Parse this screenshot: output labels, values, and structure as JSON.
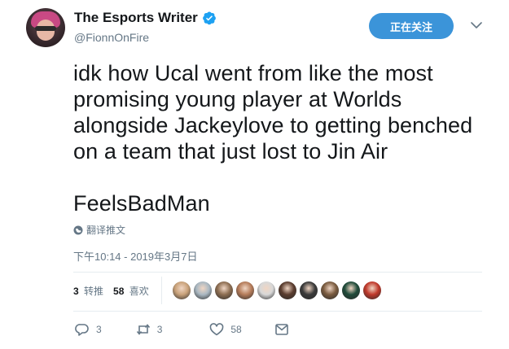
{
  "author": {
    "display_name": "The Esports Writer",
    "handle": "@FionnOnFire",
    "verified": true
  },
  "follow_button": {
    "label": "正在关注"
  },
  "tweet": {
    "text_lines": [
      "idk how Ucal went from like the most",
      "promising young player at Worlds",
      "alongside Jackeylove to getting benched",
      "on a team that just lost to Jin Air"
    ],
    "text_extra": "FeelsBadMan",
    "translate_label": "翻译推文",
    "timestamp": "下午10:14 - 2019年3月7日"
  },
  "stats": {
    "retweets_count": "3",
    "retweets_label": "转推",
    "likes_count": "58",
    "likes_label": "喜欢"
  },
  "likers": [
    {
      "color": "#c9a27a"
    },
    {
      "color": "#aab8c2"
    },
    {
      "color": "#8d6e52"
    },
    {
      "color": "#b57c5a"
    },
    {
      "color": "#d8d8d8"
    },
    {
      "color": "#5a3c2e"
    },
    {
      "color": "#3a3a3a"
    },
    {
      "color": "#7a5b3f"
    },
    {
      "color": "#1f4b3a"
    },
    {
      "color": "#c0392b"
    }
  ],
  "actions": {
    "reply_count": "3",
    "retweet_count": "3",
    "like_count": "58"
  },
  "colors": {
    "accent": "#3b94d9",
    "text_secondary": "#657786",
    "verified": "#1da1f2"
  }
}
